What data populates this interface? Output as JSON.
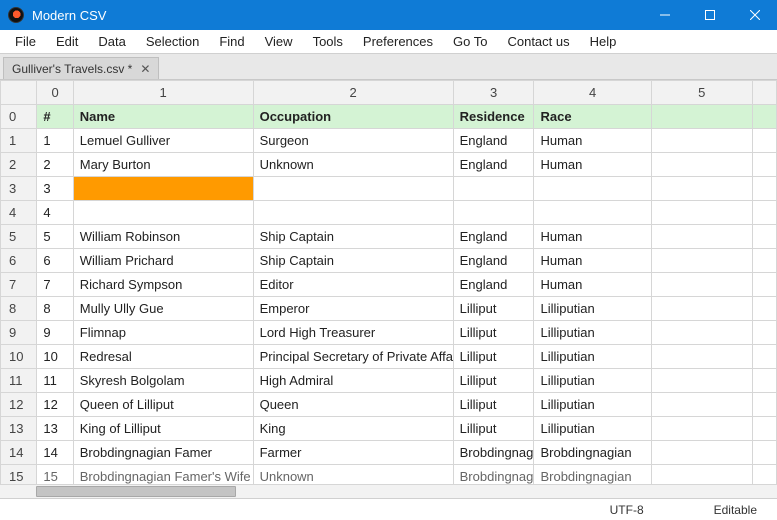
{
  "app": {
    "title": "Modern CSV"
  },
  "menu": [
    "File",
    "Edit",
    "Data",
    "Selection",
    "Find",
    "View",
    "Tools",
    "Preferences",
    "Go To",
    "Contact us",
    "Help"
  ],
  "tab": {
    "label": "Gulliver's Travels.csv *",
    "close": "✕"
  },
  "colHeaders": [
    "0",
    "1",
    "2",
    "3",
    "4",
    "5"
  ],
  "rows": [
    {
      "idx": "0",
      "header": true,
      "cells": [
        "#",
        "Name",
        "Occupation",
        "Residence",
        "Race",
        ""
      ]
    },
    {
      "idx": "1",
      "cells": [
        "1",
        "Lemuel Gulliver",
        "Surgeon",
        "England",
        "Human",
        ""
      ]
    },
    {
      "idx": "2",
      "cells": [
        "2",
        "Mary Burton",
        "Unknown",
        "England",
        "Human",
        ""
      ]
    },
    {
      "idx": "3",
      "cells": [
        "3",
        "",
        "",
        "",
        "",
        ""
      ],
      "selectedCol": 1
    },
    {
      "idx": "4",
      "cells": [
        "4",
        "",
        "",
        "",
        "",
        ""
      ]
    },
    {
      "idx": "5",
      "cells": [
        "5",
        "William Robinson",
        "Ship Captain",
        "England",
        "Human",
        ""
      ]
    },
    {
      "idx": "6",
      "cells": [
        "6",
        "William Prichard",
        "Ship Captain",
        "England",
        "Human",
        ""
      ]
    },
    {
      "idx": "7",
      "cells": [
        "7",
        "Richard Sympson",
        "Editor",
        "England",
        "Human",
        ""
      ]
    },
    {
      "idx": "8",
      "cells": [
        "8",
        "Mully Ully Gue",
        "Emperor",
        "Lilliput",
        "Lilliputian",
        ""
      ]
    },
    {
      "idx": "9",
      "cells": [
        "9",
        "Flimnap",
        "Lord High Treasurer",
        "Lilliput",
        "Lilliputian",
        ""
      ]
    },
    {
      "idx": "10",
      "cells": [
        "10",
        "Redresal",
        "Principal Secretary of Private Affairs",
        "Lilliput",
        "Lilliputian",
        ""
      ]
    },
    {
      "idx": "11",
      "cells": [
        "11",
        "Skyresh Bolgolam",
        "High Admiral",
        "Lilliput",
        "Lilliputian",
        ""
      ]
    },
    {
      "idx": "12",
      "cells": [
        "12",
        "Queen of Lilliput",
        "Queen",
        "Lilliput",
        "Lilliputian",
        ""
      ]
    },
    {
      "idx": "13",
      "cells": [
        "13",
        "King of Lilliput",
        "King",
        "Lilliput",
        "Lilliputian",
        ""
      ]
    },
    {
      "idx": "14",
      "cells": [
        "14",
        "Brobdingnagian Famer",
        "Farmer",
        "Brobdingnag",
        "Brobdingnagian",
        ""
      ]
    },
    {
      "idx": "15",
      "partial": true,
      "cells": [
        "15",
        "Brobdingnagian Famer's Wife",
        "Unknown",
        "Brobdingnag",
        "Brobdingnagian",
        ""
      ]
    }
  ],
  "status": {
    "encoding": "UTF-8",
    "mode": "Editable"
  }
}
